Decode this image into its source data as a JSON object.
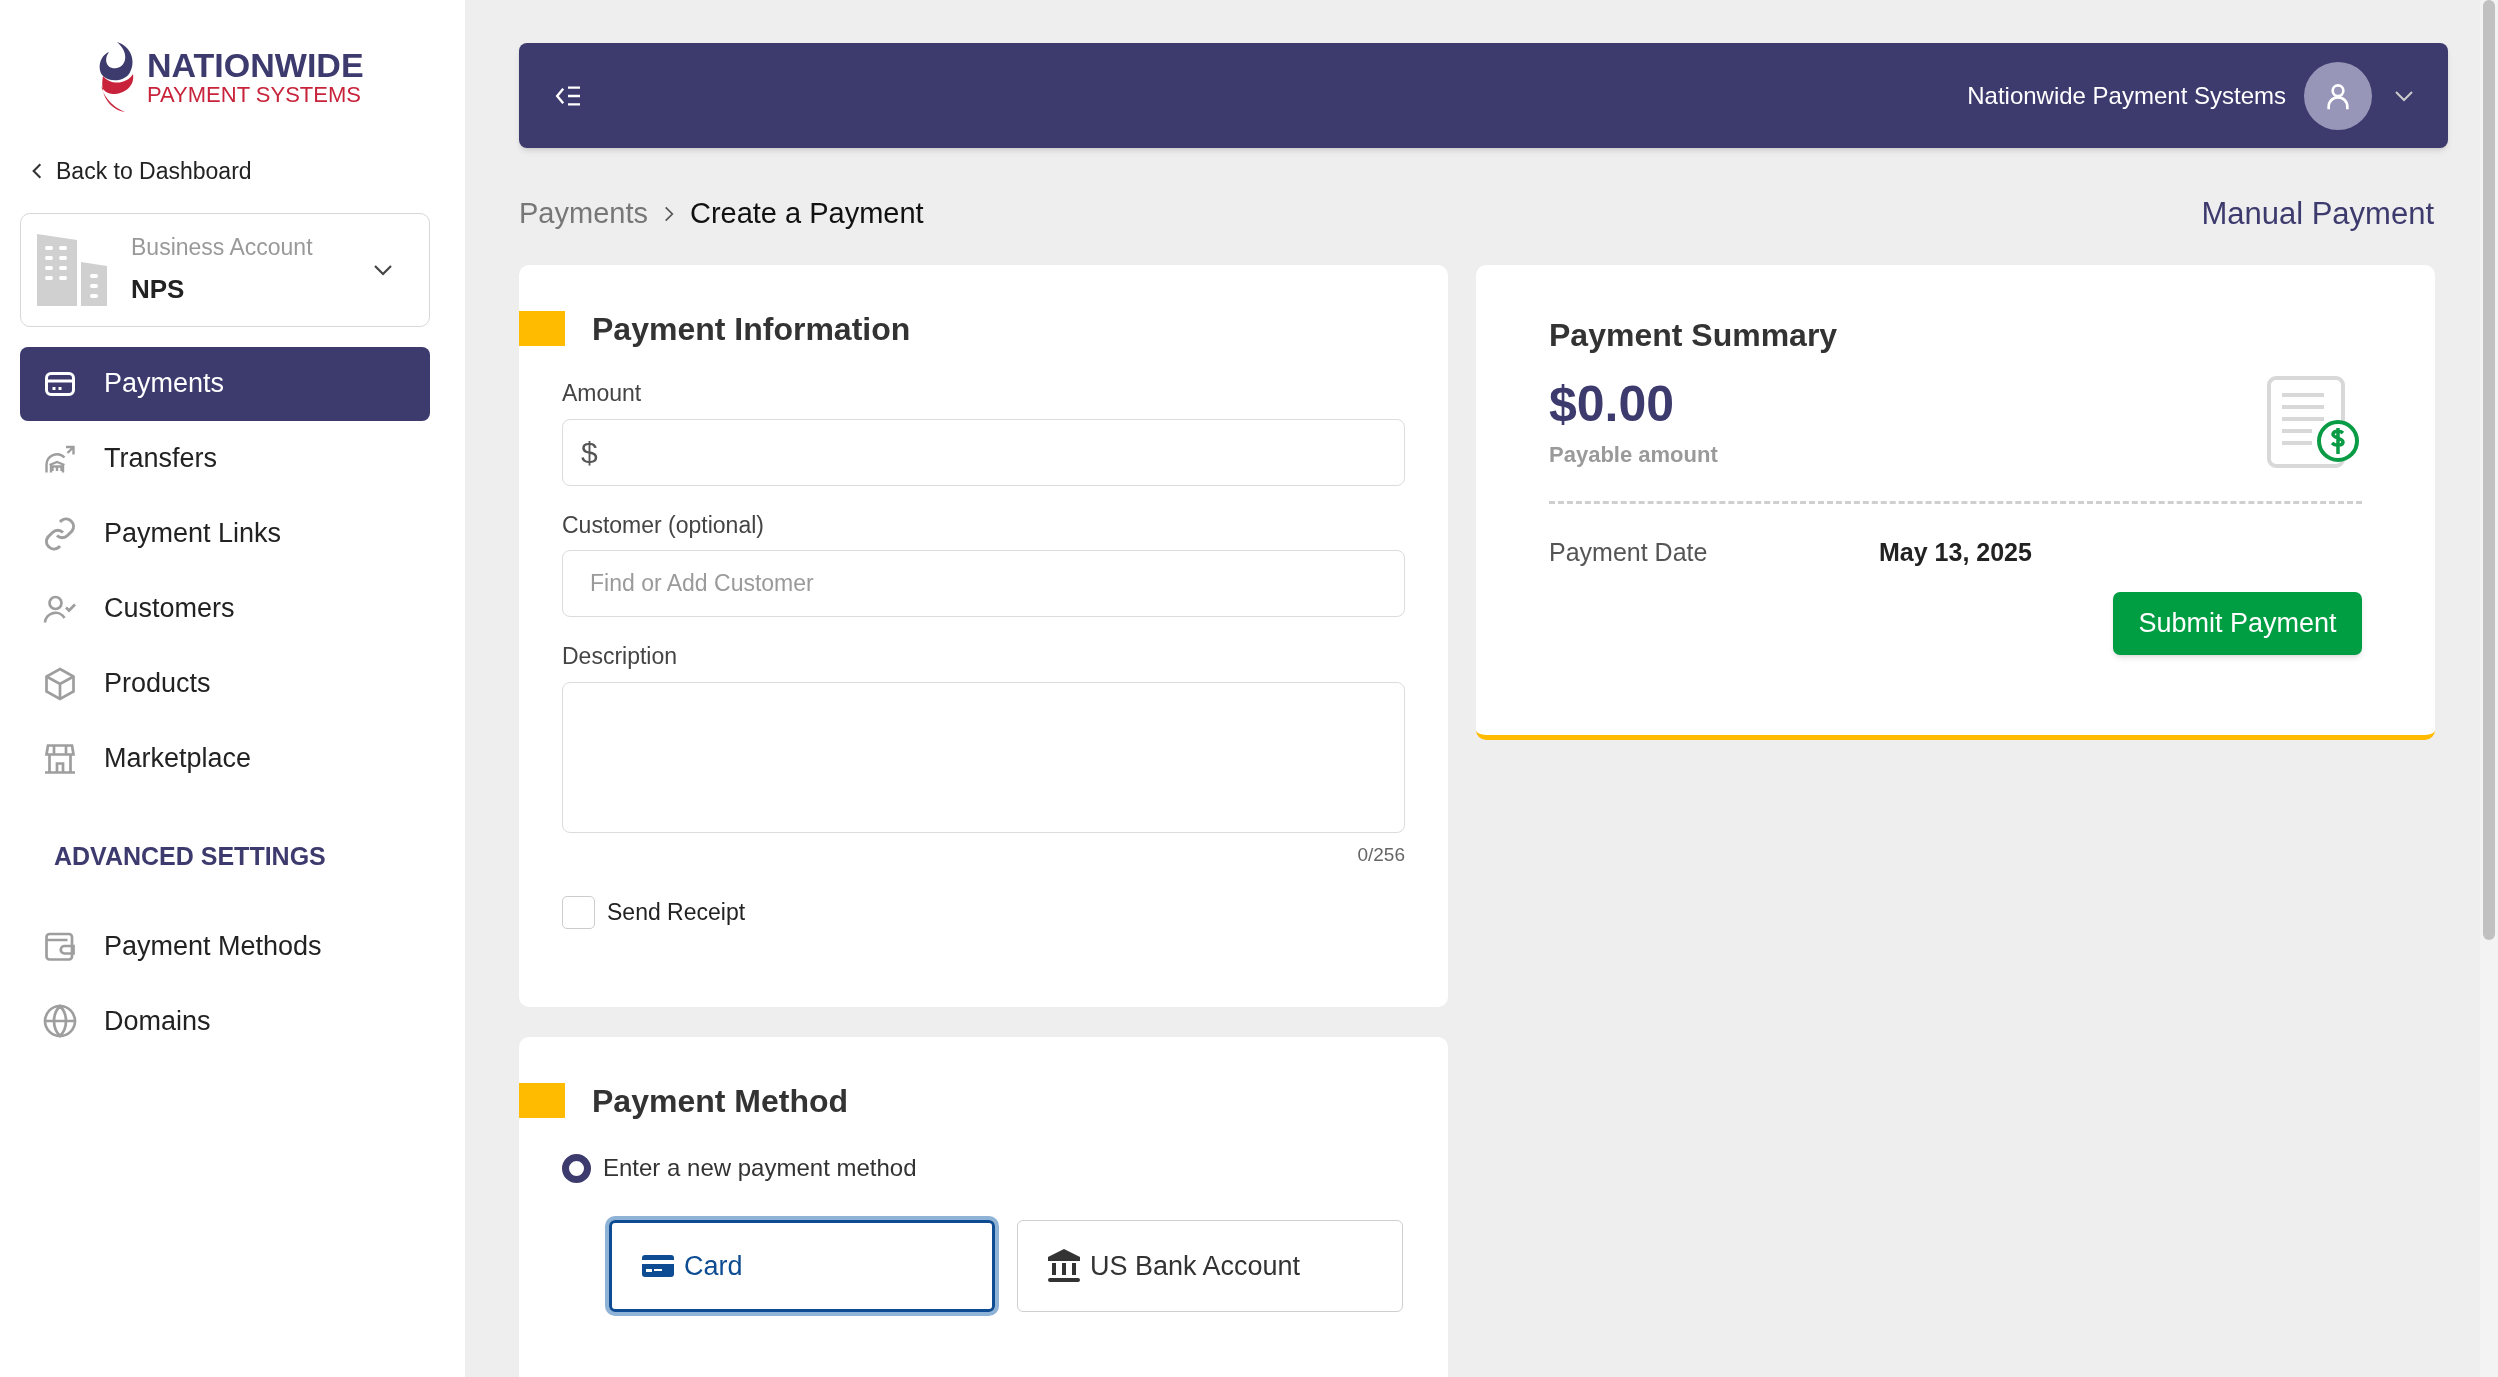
{
  "logo": {
    "name": "NATIONWIDE",
    "tagline": "PAYMENT SYSTEMS"
  },
  "back_link": {
    "label": "Back to Dashboard"
  },
  "account": {
    "label": "Business Account",
    "name": "NPS"
  },
  "nav": [
    {
      "label": "Payments",
      "selected": true
    },
    {
      "label": "Transfers",
      "selected": false
    },
    {
      "label": "Payment Links",
      "selected": false
    },
    {
      "label": "Customers",
      "selected": false
    },
    {
      "label": "Products",
      "selected": false
    },
    {
      "label": "Marketplace",
      "selected": false
    }
  ],
  "advanced_settings": {
    "heading": "ADVANCED SETTINGS",
    "items": [
      {
        "label": "Payment Methods",
        "selected": false
      },
      {
        "label": "Domains",
        "selected": false
      }
    ]
  },
  "header": {
    "company": "Nationwide Payment Systems"
  },
  "breadcrumb": [
    "Payments",
    "Create a Payment"
  ],
  "page_mode": "Manual Payment",
  "payment_info": {
    "title": "Payment Information",
    "fields": [
      {
        "kind": "amount",
        "label": "Amount",
        "prefix": "$"
      },
      {
        "kind": "text",
        "label": "Customer (optional)",
        "placeholder": "Find or Add Customer"
      },
      {
        "kind": "textarea",
        "label": "Description",
        "counter": "0/256"
      }
    ],
    "send_receipt": {
      "label": "Send Receipt",
      "checked": false
    }
  },
  "summary": {
    "title": "Payment Summary",
    "amount": "$0.00",
    "amount_label": "Payable amount",
    "date_label": "Payment Date",
    "date": "May 13, 2025",
    "submit": "Submit Payment"
  },
  "payment_method": {
    "title": "Payment Method",
    "option": {
      "label": "Enter a new payment method",
      "selected": true
    },
    "methods": [
      {
        "label": "Card",
        "selected": true
      },
      {
        "label": "US Bank Account",
        "selected": false
      }
    ]
  }
}
